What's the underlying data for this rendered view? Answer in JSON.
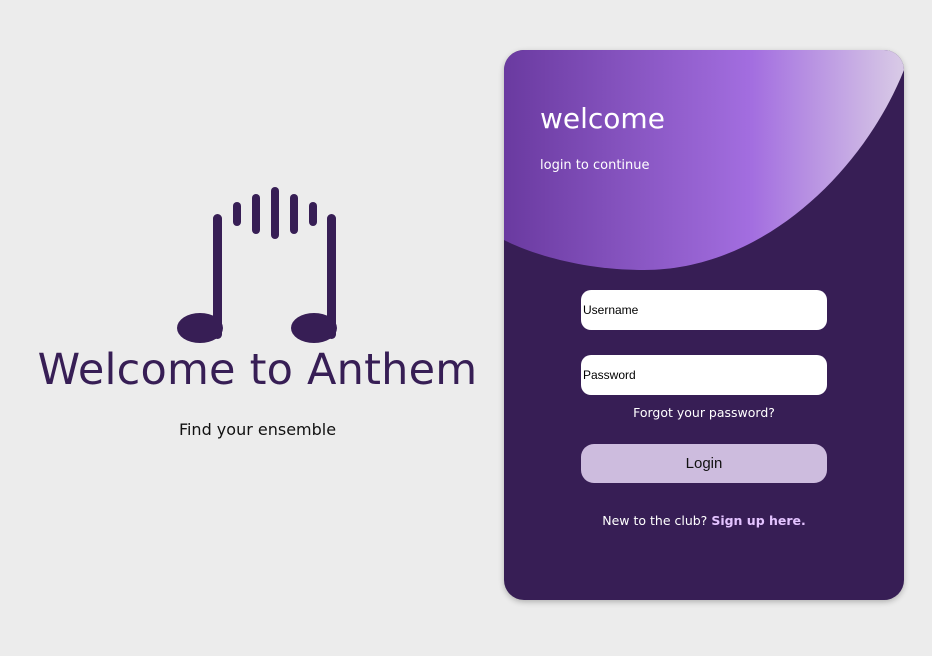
{
  "brand": {
    "title": "Welcome to Anthem",
    "tagline": "Find your ensemble",
    "logo_icon": "music-notes-with-waveform-icon",
    "color": "#371e55"
  },
  "card": {
    "heading": "welcome",
    "subheading": "login to continue",
    "username_placeholder": "Username",
    "password_placeholder": "Password",
    "forgot_label": "Forgot your password?",
    "login_label": "Login",
    "signup_prompt": "New to the club?",
    "signup_link": "Sign up here.",
    "colors": {
      "background": "#371e55",
      "gradient_start": "#6a3aa0",
      "gradient_mid": "#a36ee0",
      "gradient_end": "#d9cbe6",
      "button": "#cdbcde"
    }
  }
}
